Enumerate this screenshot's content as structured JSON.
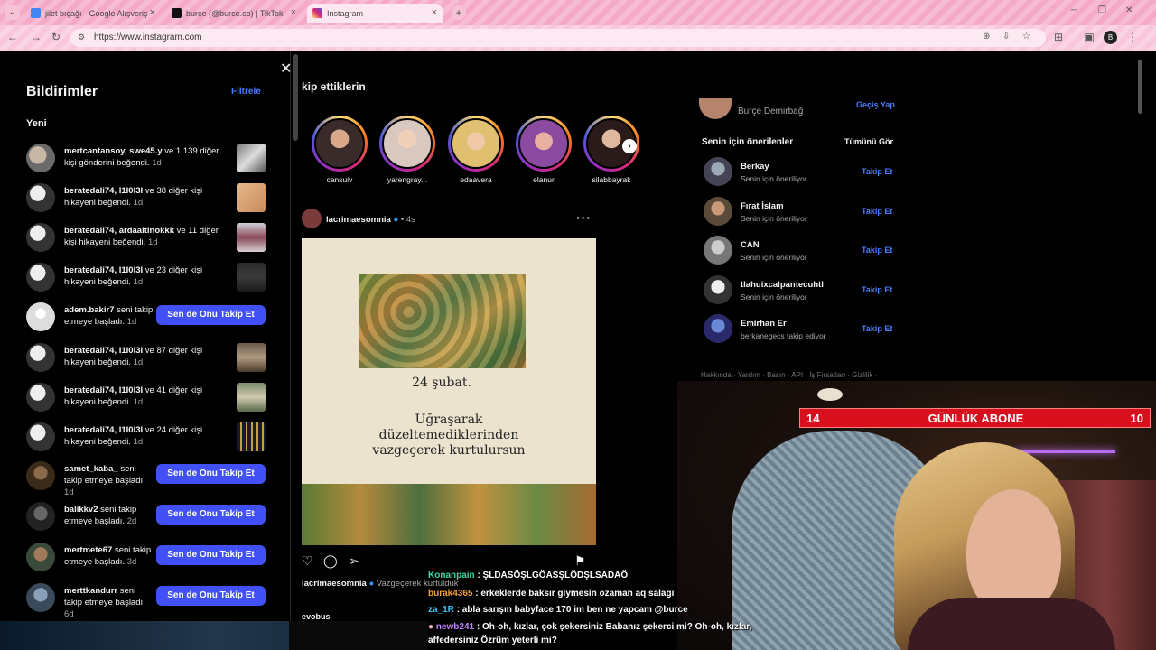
{
  "browser": {
    "tabs": [
      {
        "label": "jilet bıçağı - Google Alışveriş"
      },
      {
        "label": "burçe (@burce.co) | TikTok"
      },
      {
        "label": "Instagram"
      }
    ],
    "url": "https://www.instagram.com",
    "profile_initial": "B"
  },
  "notifications": {
    "title": "Bildirimler",
    "filter_label": "Filtrele",
    "section_new": "Yeni",
    "follow_label": "Sen de Onu Takip Et",
    "items": [
      {
        "user": "mertcantansoy, swe45.y",
        "text": " ve 1.139 diğer kişi gönderini beğendi.",
        "time": "1d"
      },
      {
        "user": "beratedali74, I1I0I3I",
        "text": " ve 38 diğer kişi hikayeni beğendi.",
        "time": "1d"
      },
      {
        "user": "beratedali74, ardaaltinokkk",
        "text": " ve 11 diğer kişi hikayeni beğendi.",
        "time": "1d"
      },
      {
        "user": "beratedali74, I1I0I3I",
        "text": " ve 23 diğer kişi hikayeni beğendi.",
        "time": "1d"
      },
      {
        "user": "adem.bakir7",
        "text": " seni takip etmeye başladı.",
        "time": "1d"
      },
      {
        "user": "beratedali74, I1I0I3I",
        "text": " ve 87 diğer kişi hikayeni beğendi.",
        "time": "1d"
      },
      {
        "user": "beratedali74, I1I0I3I",
        "text": " ve 41 diğer kişi hikayeni beğendi.",
        "time": "1d"
      },
      {
        "user": "beratedali74, I1I0I3I",
        "text": " ve 24 diğer kişi hikayeni beğendi.",
        "time": "1d"
      },
      {
        "user": "samet_kaba_",
        "text": " seni takip etmeye başladı.",
        "time": "1d"
      },
      {
        "user": "balikkv2",
        "text": " seni takip etmeye başladı.",
        "time": "2d"
      },
      {
        "user": "mertmete67",
        "text": " seni takip etmeye başladı.",
        "time": "3d"
      },
      {
        "user": "merttkandurr",
        "text": " seni takip etmeye başladı.",
        "time": "6d"
      }
    ]
  },
  "feed": {
    "title_partial": "kip ettiklerin",
    "stories": [
      {
        "name": "cansuiv"
      },
      {
        "name": "yarengray..."
      },
      {
        "name": "edaavera"
      },
      {
        "name": "elanur"
      },
      {
        "name": "silabbayrak"
      }
    ],
    "post": {
      "user": "lacrimaesomnia",
      "time": "4s",
      "image_date": "24 şubat.",
      "image_quote": [
        "Uğraşarak",
        "düzeltemediklerinden",
        "vazgeçerek kurtulursun"
      ],
      "caption_user": "lacrimaesomnia",
      "caption_text": "Vazgeçerek kurtulduk",
      "next_user": "evobus"
    }
  },
  "sidebar": {
    "me_name": "Burçe Demirbağ",
    "switch_label": "Geçiş Yap",
    "suggestions_title": "Senin için önerilenler",
    "see_all": "Tümünü Gör",
    "follow_label": "Takip Et",
    "suggestions": [
      {
        "name": "Berkay",
        "sub": "Senin için öneriliyor"
      },
      {
        "name": "Fırat İslam",
        "sub": "Senin için öneriliyor"
      },
      {
        "name": "CAN",
        "sub": "Senin için öneriliyor"
      },
      {
        "name": "tlahuixcalpantecuhtl",
        "sub": "Senin için öneriliyor"
      },
      {
        "name": "Emirhan Er",
        "sub": "berkanegecs takip ediyor"
      }
    ],
    "footer": "Hakkında · Yardım · Basın · API · İş Fırsatları · Gizlilik ·"
  },
  "stream": {
    "sub_goal": {
      "left": "14",
      "label": "GÜNLÜK ABONE",
      "right": "10"
    },
    "chat": [
      {
        "user": "Konanpain",
        "msg": ": ŞLDASÖŞLGÖASŞLÖDŞLSADAÖ"
      },
      {
        "user": "burak4365",
        "msg": ": erkeklerde baksır giymesin ozaman aq salagı"
      },
      {
        "user": "za_1R",
        "msg": ": abla sarışın babyface 170 im ben ne yapcam @burce"
      },
      {
        "user": "newb241",
        "msg": ": Oh-oh, kızlar, çok şekersiniz Babanız şekerci mi? Oh-oh, kızlar,"
      },
      {
        "user": "",
        "msg": "affedersiniz Özrüm yeterli mi?"
      }
    ]
  }
}
